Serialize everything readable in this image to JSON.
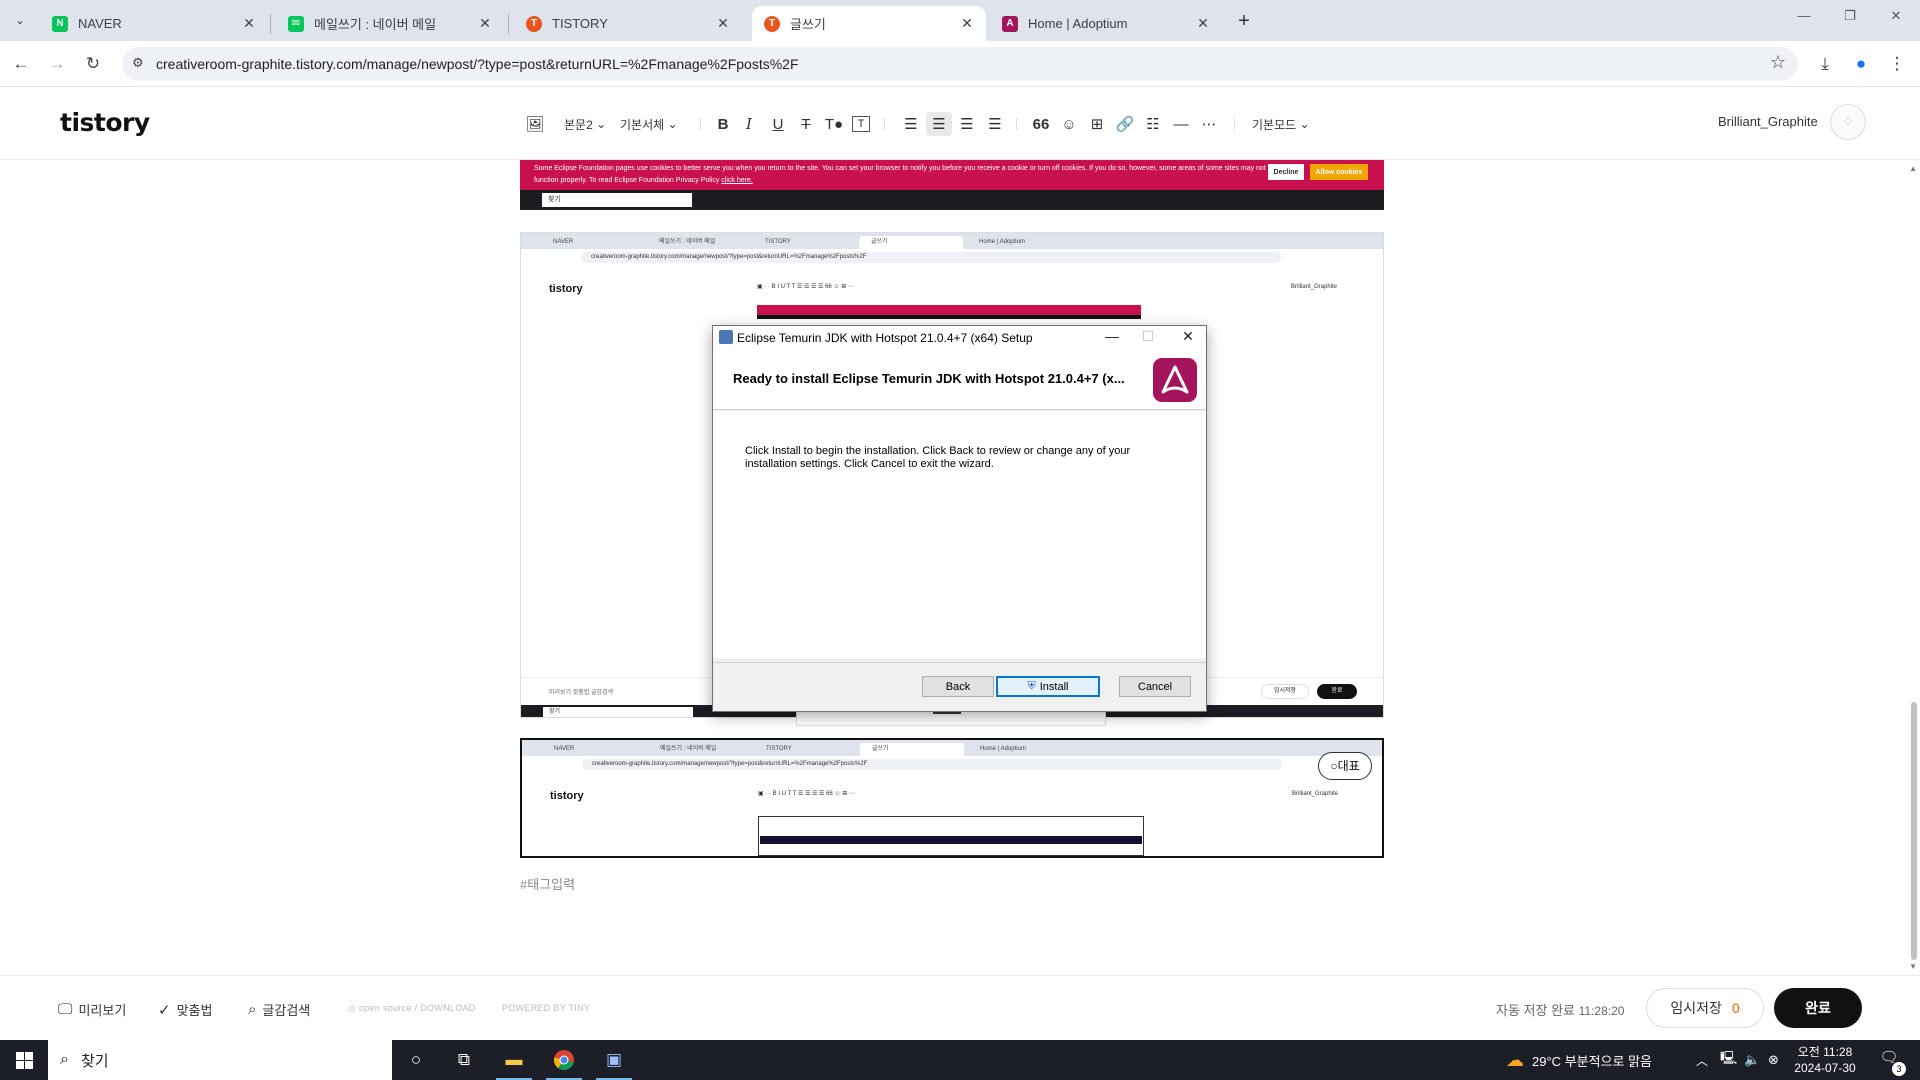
{
  "browser": {
    "tabs": [
      {
        "title": "NAVER",
        "favicon_color": "#03c75a",
        "favicon_glyph": "N",
        "active": false
      },
      {
        "title": "메일쓰기 : 네이버 메일",
        "favicon_color": "#03c75a",
        "favicon_glyph": "✉",
        "active": false
      },
      {
        "title": "TISTORY",
        "favicon_color": "#eb531f",
        "favicon_glyph": "T",
        "active": false
      },
      {
        "title": "글쓰기",
        "favicon_color": "#eb531f",
        "favicon_glyph": "T",
        "active": true
      },
      {
        "title": "Home | Adoptium",
        "favicon_color": "#a3145c",
        "favicon_glyph": "A",
        "active": false
      }
    ],
    "url": "creativeroom-graphite.tistory.com/manage/newpost/?type=post&returnURL=%2Fmanage%2Fposts%2F"
  },
  "editor": {
    "logo": "tistory",
    "toolbar": {
      "paragraph": "본문2",
      "font": "기본서체",
      "mode": "기본모드"
    },
    "username": "Brilliant_Graphite",
    "tag_placeholder": "#태그입력",
    "representative_badge": "대표",
    "footer": {
      "preview": "미리보기",
      "spellcheck": "맞춤법",
      "search": "글감검색",
      "opensource": "open source / DOWNLOAD",
      "powered": "POWERED BY TINY",
      "autosave_label": "자동 저장 완료",
      "autosave_time": "11:28:20",
      "temp_save": "임시저장",
      "temp_save_count": "0",
      "done": "완료"
    }
  },
  "embedded": {
    "cookie_banner": "Some Eclipse Foundation pages use cookies to better serve you when you return to the site. You can set your browser to notify you before you receive a cookie or turn off cookies. If you do so, however, some areas of some sites may not function properly. To read Eclipse Foundation Privacy Policy",
    "cookie_link": "click here.",
    "cookie_decline": "Decline",
    "cookie_allow": "Allow cookies",
    "mini_search": "찾기",
    "mini_tabs": [
      "NAVER",
      "메일쓰기 : 네이버 메일",
      "TISTORY",
      "글쓰기",
      "Home | Adoptium"
    ],
    "mini_url": "creativeroom-graphite.tistory.com/manage/newpost/?type=post&returnURL=%2Fmanage%2Fposts%2F",
    "mini_logo": "tistory",
    "mini_user": "Brilliant_Graphite",
    "mini_footer_text": "미리보기   맞춤법   글감검색",
    "mini_save": "임시저장",
    "mini_done": "완료"
  },
  "dialog": {
    "title": "Eclipse Temurin JDK with Hotspot 21.0.4+7 (x64) Setup",
    "heading": "Ready to install Eclipse Temurin JDK with Hotspot 21.0.4+7 (x...",
    "description": "Click Install to begin the installation. Click Back to review or change any of your installation settings. Click Cancel to exit the wizard.",
    "back": "Back",
    "install": "Install",
    "cancel": "Cancel"
  },
  "taskbar": {
    "search": "찾기",
    "weather": "29°C  부분적으로 맑음",
    "time": "오전 11:28",
    "date": "2024-07-30",
    "notifications": "3"
  }
}
